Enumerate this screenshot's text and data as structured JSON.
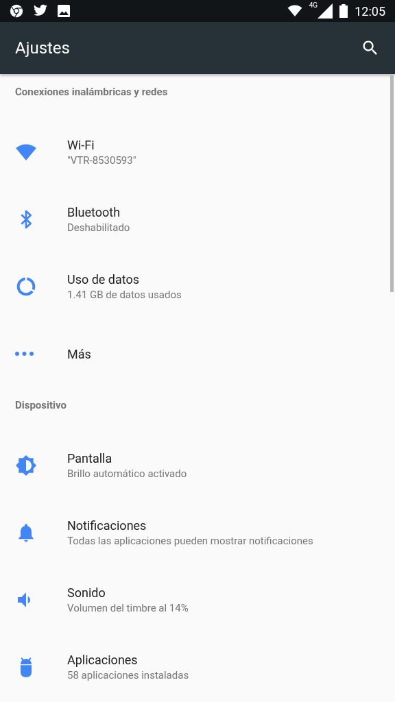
{
  "status_bar": {
    "network_type": "4G",
    "time": "12:05"
  },
  "app_bar": {
    "title": "Ajustes"
  },
  "sections": [
    {
      "header": "Conexiones inalámbricas y redes",
      "items": [
        {
          "title": "Wi-Fi",
          "subtitle": "\"VTR-8530593\""
        },
        {
          "title": "Bluetooth",
          "subtitle": "Deshabilitado"
        },
        {
          "title": "Uso de datos",
          "subtitle": "1.41 GB de datos usados"
        },
        {
          "title": "Más"
        }
      ]
    },
    {
      "header": "Dispositivo",
      "items": [
        {
          "title": "Pantalla",
          "subtitle": "Brillo automático activado"
        },
        {
          "title": "Notificaciones",
          "subtitle": "Todas las aplicaciones pueden mostrar notificaciones"
        },
        {
          "title": "Sonido",
          "subtitle": "Volumen del timbre al 14%"
        },
        {
          "title": "Aplicaciones",
          "subtitle": "58 aplicaciones instaladas"
        }
      ]
    }
  ]
}
